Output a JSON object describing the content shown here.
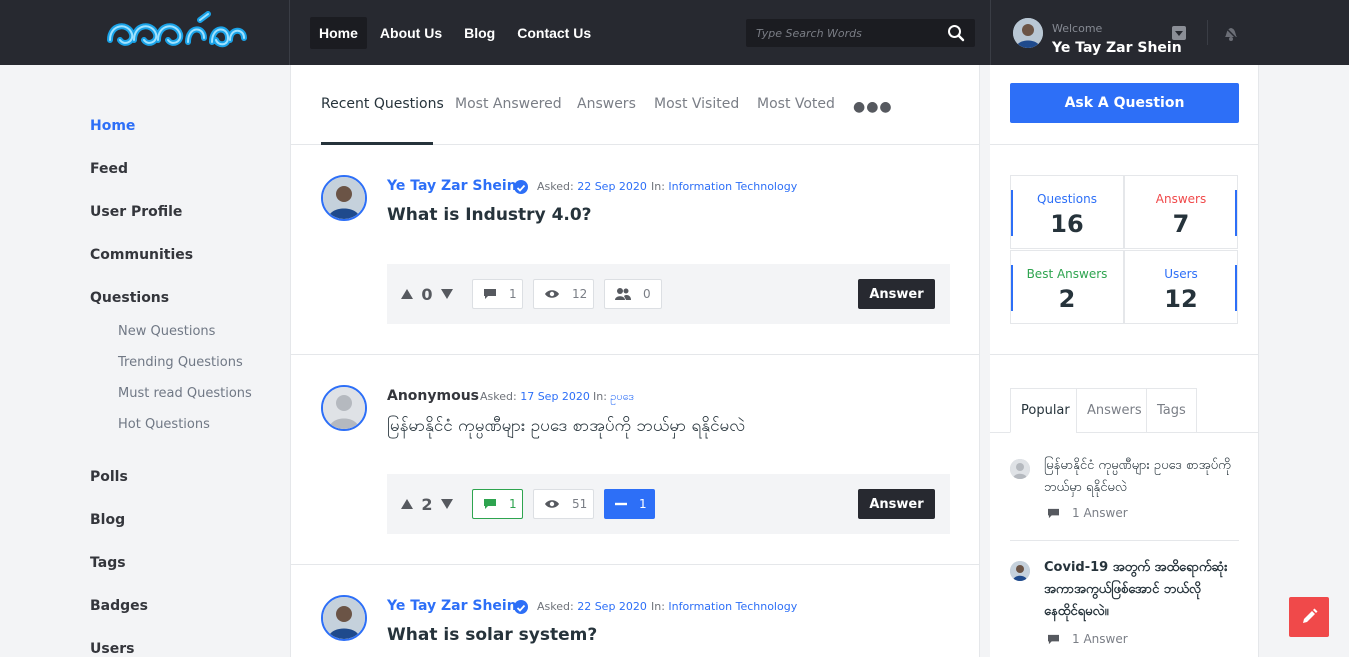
{
  "header": {
    "logo_text": "ခဘား ဗိုင်း",
    "nav": [
      "Home",
      "About Us",
      "Blog",
      "Contact Us"
    ],
    "search_placeholder": "Type Search Words",
    "welcome": "Welcome",
    "user_name": "Ye Tay Zar Shein"
  },
  "sidebar": {
    "items": [
      "Home",
      "Feed",
      "User Profile",
      "Communities",
      "Questions",
      "Polls",
      "Blog",
      "Tags",
      "Badges",
      "Users"
    ],
    "sub_items": [
      "New Questions",
      "Trending Questions",
      "Must read Questions",
      "Hot Questions"
    ]
  },
  "tabs": [
    "Recent Questions",
    "Most Answered",
    "Answers",
    "Most Visited",
    "Most Voted"
  ],
  "questions": [
    {
      "author": "Ye Tay Zar Shein",
      "asked_label": "Asked:",
      "asked_date": "22 Sep 2020",
      "in_label": "In:",
      "category": "Information Technology",
      "title": "What is Industry 4.0?",
      "votes": "0",
      "comments": "1",
      "views": "12",
      "followers": "0",
      "answer_label": "Answer"
    },
    {
      "author": "Anonymous",
      "asked_label": "Asked:",
      "asked_date": "17 Sep 2020",
      "in_label": "In:",
      "category": "ဥပဒေ",
      "title": "မြန်မာနိုင်ငံ ကုမ္ပဏီများ ဥပဒေ စာအုပ်ကို ဘယ်မှာ ရနိုင်မလဲ",
      "votes": "2",
      "comments": "1",
      "views": "51",
      "followers": "1",
      "answer_label": "Answer"
    },
    {
      "author": "Ye Tay Zar Shein",
      "asked_label": "Asked:",
      "asked_date": "22 Sep 2020",
      "in_label": "In:",
      "category": "Information Technology",
      "title": "What is solar system?"
    }
  ],
  "right": {
    "ask_label": "Ask A Question",
    "stats": [
      {
        "label": "Questions",
        "value": "16",
        "color": "#2d6ff7"
      },
      {
        "label": "Answers",
        "value": "7",
        "color": "#f0494a"
      },
      {
        "label": "Best Answers",
        "value": "2",
        "color": "#2ea44f"
      },
      {
        "label": "Users",
        "value": "12",
        "color": "#2d6ff7"
      }
    ],
    "widget_tabs": [
      "Popular",
      "Answers",
      "Tags"
    ],
    "popular": [
      {
        "title": "မြန်မာနိုင်ငံ ကုမ္ပဏီများ ဥပဒေ စာအုပ်ကို ဘယ်မှာ ရနိုင်မလဲ",
        "answers": "1 Answer"
      },
      {
        "title": "Covid-19 အတွက် အထိရောက်ဆုံး အကာအကွယ်ဖြစ်အောင် ဘယ်လို နေထိုင်ရမလဲ။",
        "answers": "1 Answer"
      }
    ]
  },
  "colors": {
    "accent": "#2d6ff7",
    "header_bg": "#272930",
    "danger": "#f0494a",
    "success": "#2ea44f"
  }
}
